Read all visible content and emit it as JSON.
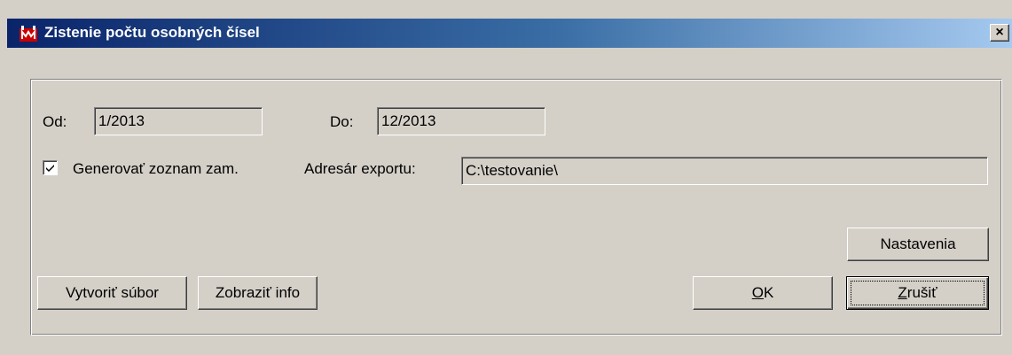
{
  "window": {
    "title": "Zistenie počtu osobných čísel",
    "close_label": "×"
  },
  "form": {
    "od_label": "Od:",
    "od_value": "1/2013",
    "do_label": "Do:",
    "do_value": "12/2013",
    "generate_checkbox": {
      "label": "Generovať zoznam zam.",
      "checked": true
    },
    "export_dir_label": "Adresár exportu:",
    "export_dir_value": "C:\\testovanie\\"
  },
  "buttons": {
    "settings": "Nastavenia",
    "create_file": "Vytvoriť súbor",
    "show_info": "Zobraziť info",
    "ok_accel": "O",
    "ok_rest": "K",
    "cancel_accel": "Z",
    "cancel_rest": "rušiť"
  },
  "colors": {
    "titlebar_start": "#0a246a",
    "titlebar_end": "#a6caf0",
    "face": "#d4d0c8",
    "app_icon": "#cc0000"
  },
  "icons": {
    "app": "app-icon",
    "close": "close-icon",
    "check": "checkmark-icon"
  }
}
